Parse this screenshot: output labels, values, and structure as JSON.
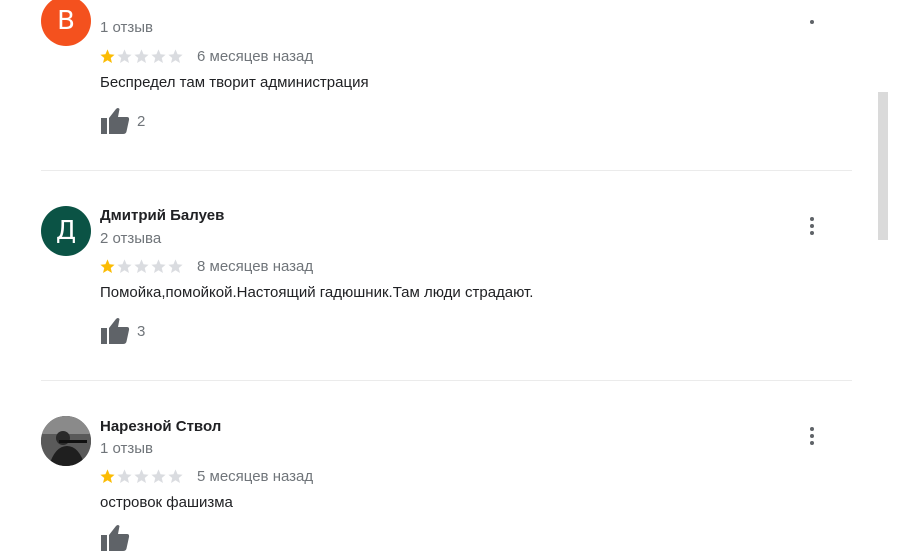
{
  "reviews": [
    {
      "avatar_letter": "В",
      "avatar_color": "#f4511e",
      "name": "",
      "reviews_count": "1 отзыв",
      "rating": 1,
      "date": "6 месяцев назад",
      "text": "Беспредел там творит администрация",
      "likes": "2"
    },
    {
      "avatar_letter": "Д",
      "avatar_color": "#0b5345",
      "name": "Дмитрий Балуев",
      "reviews_count": "2 отзыва",
      "rating": 1,
      "date": "8 месяцев назад",
      "text": "Помойка,помойкой.Настоящий гадюшник.Там люди страдают.",
      "likes": "3"
    },
    {
      "avatar_letter": "",
      "avatar_color": "#4a4a4a",
      "name": "Нарезной Ствол",
      "reviews_count": "1 отзыв",
      "rating": 1,
      "date": "5 месяцев назад",
      "text": "островок фашизма",
      "likes": ""
    }
  ],
  "icons": {
    "star_filled_color": "#fbbc04",
    "star_empty_color": "#dadce0",
    "like_icon_color": "#5f6368",
    "menu_icon": "more-vert-icon",
    "like_icon": "thumb-up-icon"
  }
}
